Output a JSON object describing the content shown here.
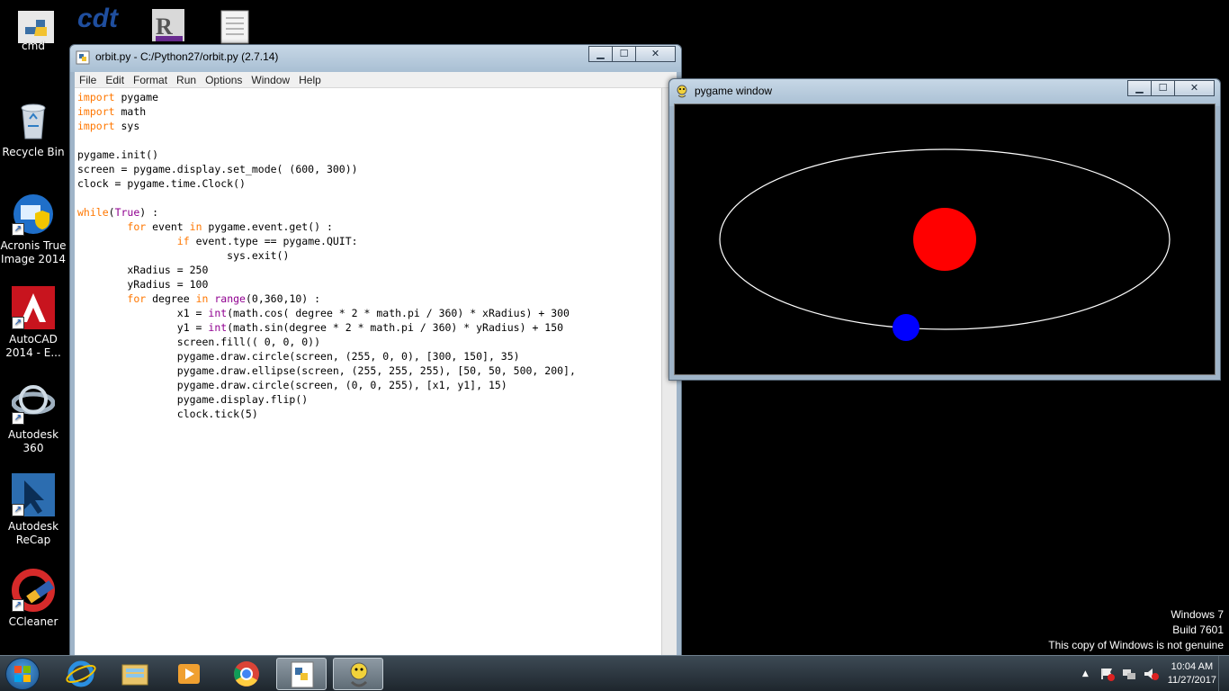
{
  "desktop": {
    "icons": [
      {
        "label": "cmd"
      },
      {
        "label": "Recycle Bin"
      },
      {
        "label": "Acronis True Image 2014"
      },
      {
        "label": "AutoCAD 2014 - E..."
      },
      {
        "label": "Autodesk 360"
      },
      {
        "label": "Autodesk ReCap"
      },
      {
        "label": "CCleaner"
      }
    ],
    "top_icons": [
      "cdt"
    ]
  },
  "idle": {
    "title": "orbit.py - C:/Python27/orbit.py (2.7.14)",
    "menu": [
      "File",
      "Edit",
      "Format",
      "Run",
      "Options",
      "Window",
      "Help"
    ],
    "code_lines": [
      "import pygame",
      "import math",
      "import sys",
      "",
      "pygame.init()",
      "screen = pygame.display.set_mode( (600, 300))",
      "clock = pygame.time.Clock()",
      "",
      "while(True) :",
      "        for event in pygame.event.get() :",
      "                if event.type == pygame.QUIT:",
      "                        sys.exit()",
      "        xRadius = 250",
      "        yRadius = 100",
      "        for degree in range(0,360,10) :",
      "                x1 = int(math.cos( degree * 2 * math.pi / 360) * xRadius) + 300",
      "                y1 = int(math.sin(degree * 2 * math.pi / 360) * yRadius) + 150",
      "                screen.fill(( 0, 0, 0))",
      "                pygame.draw.circle(screen, (255, 0, 0), [300, 150], 35)",
      "                pygame.draw.ellipse(screen, (255, 255, 255), [50, 50, 500, 200],",
      "                pygame.draw.circle(screen, (0, 0, 255), [x1, y1], 15)",
      "                pygame.display.flip()",
      "                clock.tick(5)"
    ]
  },
  "pygame": {
    "title": "pygame window",
    "sun_color": "#ff0000",
    "planet_color": "#0000ff",
    "orbit_color": "#ffffff"
  },
  "controls": {
    "minimize": "▁",
    "maximize": "☐",
    "close": "✕"
  },
  "watermark": {
    "line1": "Windows 7",
    "line2": "Build 7601",
    "line3": "This copy of Windows is not genuine"
  },
  "taskbar": {
    "time": "10:04 AM",
    "date": "11/27/2017",
    "tray_expand": "▲"
  }
}
